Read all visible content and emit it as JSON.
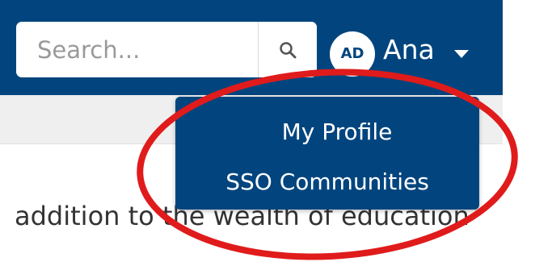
{
  "search": {
    "placeholder": "Search...",
    "value": "",
    "icon": "search-icon"
  },
  "user": {
    "initials": "AD",
    "name": "Ana",
    "caret_icon": "caret-down-icon"
  },
  "dropdown": {
    "items": [
      {
        "label": "My Profile"
      },
      {
        "label": "SSO Communities"
      }
    ]
  },
  "content": {
    "text": "addition to the wealth of education"
  },
  "colors": {
    "nav_bg": "#02457e",
    "dropdown_bg": "#02457e",
    "highlight": "#e01b1b",
    "subbar_bg": "#efefef"
  }
}
